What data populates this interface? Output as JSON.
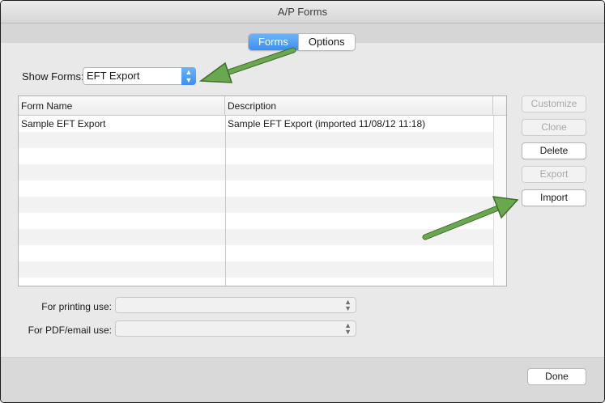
{
  "window": {
    "title": "A/P Forms"
  },
  "tabs": [
    {
      "label": "Forms",
      "active": true
    },
    {
      "label": "Options",
      "active": false
    }
  ],
  "show_forms": {
    "label": "Show Forms:",
    "selected": "EFT Export"
  },
  "table": {
    "columns": [
      "Form Name",
      "Description"
    ],
    "rows": [
      {
        "form_name": "Sample EFT Export",
        "description": "Sample EFT Export (imported 11/08/12 11:18)"
      }
    ]
  },
  "side_buttons": {
    "customize": "Customize",
    "clone": "Clone",
    "delete": "Delete",
    "export": "Export",
    "import": "Import"
  },
  "printing_use": {
    "label": "For printing use:",
    "value": ""
  },
  "pdf_email_use": {
    "label": "For PDF/email use:",
    "value": ""
  },
  "done_button": "Done",
  "colors": {
    "accent_blue": "#3c8ff0",
    "annotation_arrow": "#6aa84f"
  }
}
